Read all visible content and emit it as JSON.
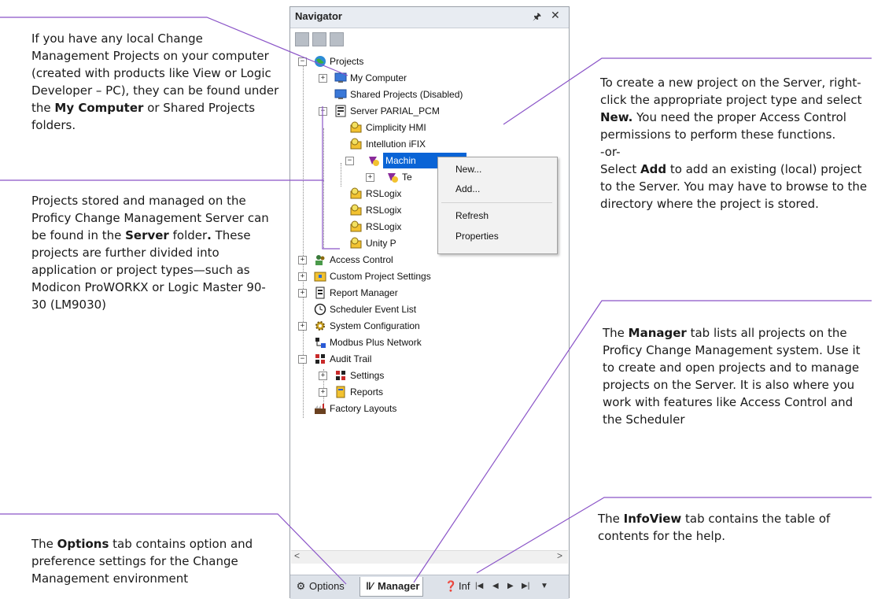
{
  "callouts": {
    "my_computer": {
      "pre": "If you have any local Change Management Projects on your computer (created with products like View or Logic Developer – PC), they can be found under the ",
      "bold": "My Computer",
      "post": " or Shared Projects folders."
    },
    "server": {
      "pre": "Projects stored and managed on the Proficy Change Management Server can be found in the ",
      "bold": "Server",
      "mid": " folder",
      "bold2": ".",
      "post": " These projects are further divided into application or project types—such as Modicon ProWORKX or Logic Master 90-30 (LM9030)"
    },
    "new_project": {
      "pre": "To create a new project on the Server, right-click the appropriate project type and select ",
      "bold": "New.",
      "post": " You need the proper Access Control permissions to perform these functions.",
      "or": "-or-",
      "pre2": "Select ",
      "bold2": "Add",
      "post2": "  to add an existing (local) project to the Server. You may have to browse to the directory where the project is stored."
    },
    "manager": {
      "pre": "The ",
      "bold": "Manager",
      "post": " tab lists all projects on the Proficy Change Management system. Use it to create and open projects and to manage projects on the Server. It is also where you work with features like Access Control and the Scheduler"
    },
    "infoview": {
      "pre": "The ",
      "bold": "InfoView",
      "post": " tab contains the table of contents for the help."
    },
    "options": {
      "pre": "The ",
      "bold": "Options",
      "post": " tab contains option and preference settings for the Change Management environment"
    }
  },
  "navigator": {
    "title": "Navigator",
    "pin": "p",
    "close": "×",
    "tree": {
      "projects": "Projects",
      "my_computer": "My Computer",
      "shared_projects": "Shared Projects (Disabled)",
      "server": "Server PARIAL_PCM",
      "cimplicity": "Cimplicity HMI",
      "intellution": "Intellution iFIX",
      "machine": "Machin",
      "te": "Te",
      "rslogix1": "RSLogix",
      "rslogix2": "RSLogix",
      "rslogix3": "RSLogix",
      "unity": "Unity P",
      "access_control": "Access Control",
      "custom_settings": "Custom Project Settings",
      "report_manager": "Report Manager",
      "scheduler": "Scheduler Event List",
      "system_config": "System Configuration",
      "modbus": "Modbus Plus Network",
      "audit_trail": "Audit Trail",
      "settings": "Settings",
      "reports": "Reports",
      "factory_layouts": "Factory Layouts"
    },
    "context_menu": {
      "new": "New...",
      "add": "Add...",
      "refresh": "Refresh",
      "properties": "Properties"
    },
    "tabs": {
      "options": "Options",
      "manager": "Manager",
      "inf": "Inf"
    }
  }
}
